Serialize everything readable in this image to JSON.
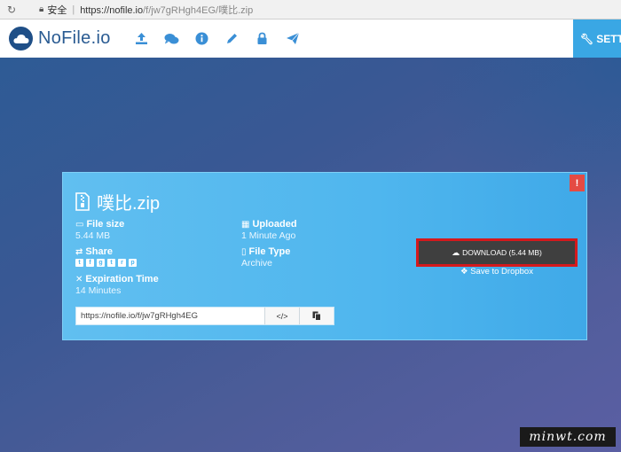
{
  "browser": {
    "reload_icon": "reload-icon",
    "secure_label": "安全",
    "url_host": "https://nofile.io",
    "url_path": "/f/jw7gRHgh4EG/噗比.zip"
  },
  "header": {
    "logo_text": "NoFile.io",
    "nav_icons": [
      "upload-icon",
      "chat-icon",
      "info-icon",
      "pencil-icon",
      "lock-icon",
      "send-icon"
    ],
    "settings_label": "SETTINGS"
  },
  "file": {
    "name": "噗比.zip",
    "size_label": "File size",
    "size_value": "5.44 MB",
    "uploaded_label": "Uploaded",
    "uploaded_value": "1 Minute Ago",
    "share_label": "Share",
    "share_icons": [
      "twitter-icon",
      "facebook-icon",
      "google-plus-icon",
      "tumblr-icon",
      "reddit-icon",
      "pinterest-icon"
    ],
    "type_label": "File Type",
    "type_value": "Archive",
    "expire_label": "Expiration Time",
    "expire_value": "14 Minutes",
    "link_value": "https://nofile.io/f/jw7gRHgh4EG",
    "embed_label": "</>",
    "download_label": "DOWNLOAD (5.44 MB)",
    "dropbox_label": "Save to Dropbox",
    "report_label": "!"
  },
  "watermark": "minwt.com",
  "colors": {
    "accent": "#3aa7e4",
    "card": "#4fb6ee",
    "download_bg": "#3f3f3f",
    "highlight": "#d4191d",
    "report": "#e44b43"
  }
}
